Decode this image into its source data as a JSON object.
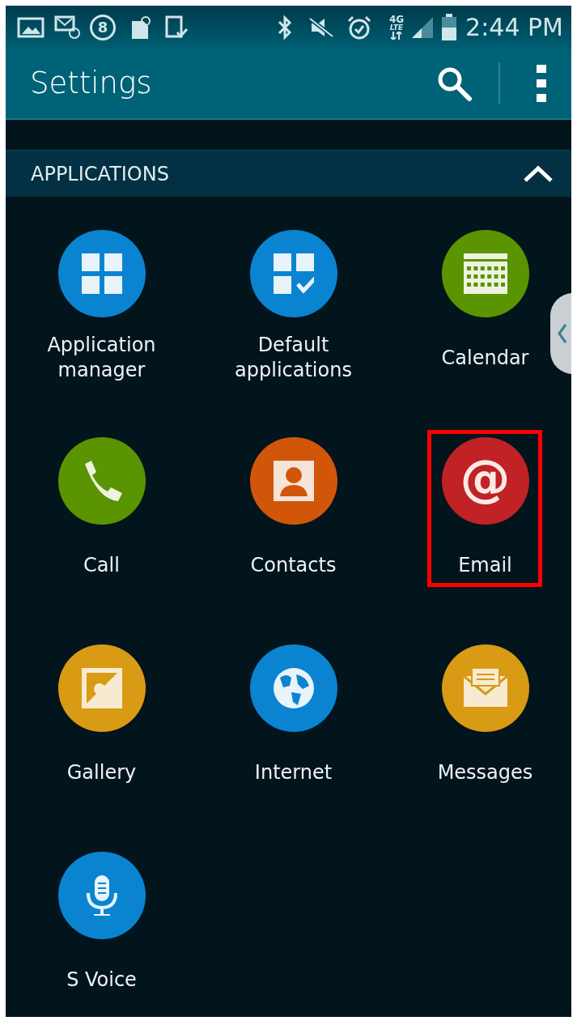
{
  "status_bar": {
    "badge_number": "8",
    "network": "4G",
    "network_sub": "LTE",
    "time": "2:44 PM"
  },
  "app_bar": {
    "title": "Settings"
  },
  "section": {
    "title": "APPLICATIONS",
    "expanded": true
  },
  "items": [
    {
      "label": "Application manager",
      "kind": "grid",
      "color": "#0a84d0",
      "highlighted": false
    },
    {
      "label": "Default applications",
      "kind": "defaults",
      "color": "#0a84d0",
      "highlighted": false
    },
    {
      "label": "Calendar",
      "kind": "calendar",
      "color": "#5a9400",
      "highlighted": false
    },
    {
      "label": "Call",
      "kind": "phone",
      "color": "#5a9400",
      "highlighted": false
    },
    {
      "label": "Contacts",
      "kind": "contacts",
      "color": "#d2560a",
      "highlighted": false
    },
    {
      "label": "Email",
      "kind": "at",
      "glyph": "@",
      "color": "#c02226",
      "highlighted": true
    },
    {
      "label": "Gallery",
      "kind": "gallery",
      "color": "#d99a14",
      "highlighted": false
    },
    {
      "label": "Internet",
      "kind": "globe",
      "color": "#0a84d0",
      "highlighted": false
    },
    {
      "label": "Messages",
      "kind": "envelope",
      "color": "#d99a14",
      "highlighted": false
    },
    {
      "label": "S Voice",
      "kind": "mic",
      "color": "#0a84d0",
      "highlighted": false
    }
  ]
}
